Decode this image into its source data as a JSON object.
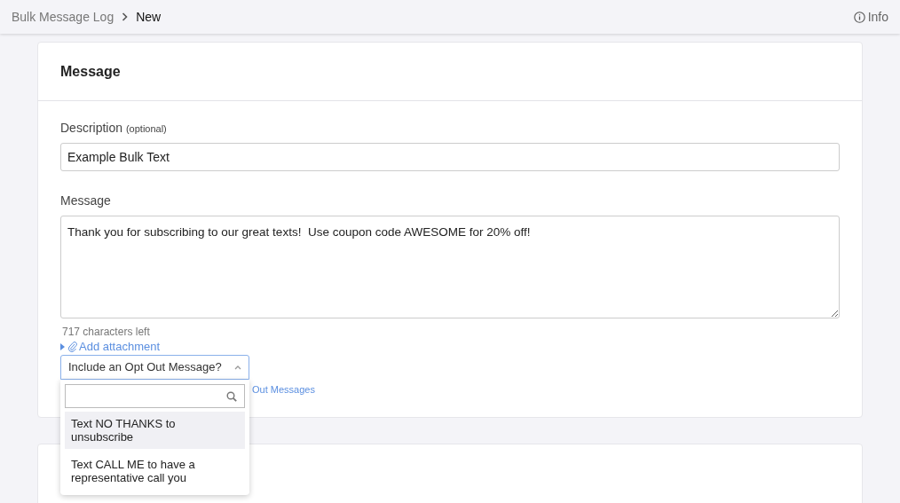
{
  "breadcrumb": {
    "items": [
      "Bulk Message Log",
      "New"
    ],
    "info": "Info"
  },
  "card": {
    "title": "Message",
    "description": {
      "label": "Description",
      "hint": "(optional)",
      "value": "Example Bulk Text"
    },
    "message": {
      "label": "Message",
      "value": "Thank you for subscribing to our great texts!  Use coupon code AWESOME for 20% off!",
      "counter": "717 characters left"
    },
    "attachment_link": "Add attachment",
    "opt_out_select": {
      "value": "Include an Opt Out Message?",
      "expanded": true,
      "link": "Out Messages",
      "options": [
        {
          "label": "Text NO THANKS to unsubscribe",
          "selected": true
        },
        {
          "label": "Text CALL ME to have a representative call you",
          "selected": false
        }
      ]
    }
  }
}
